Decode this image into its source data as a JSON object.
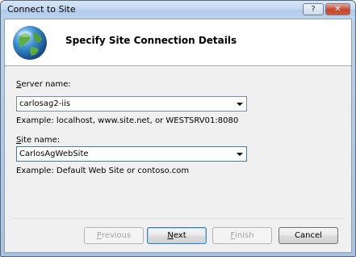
{
  "window": {
    "title": "Connect to Site",
    "help_glyph": "?",
    "close_glyph": "✕"
  },
  "header": {
    "title": "Specify Site Connection Details"
  },
  "server": {
    "label_accel": "S",
    "label_rest": "erver name:",
    "value": "carlosag2-iis",
    "example": "Example: localhost, www.site.net, or WESTSRV01:8080"
  },
  "site": {
    "label_accel": "S",
    "label_rest": "ite name:",
    "value": "CarlosAgWebSite",
    "example": "Example: Default Web Site or contoso.com"
  },
  "buttons": {
    "previous": {
      "accel": "P",
      "rest": "revious"
    },
    "next": {
      "accel": "N",
      "rest": "ext"
    },
    "finish": {
      "accel": "F",
      "rest": "inish"
    },
    "cancel": "Cancel"
  },
  "colors": {
    "accent": "#3c7fb1",
    "title_bar": "#c2d7ee"
  },
  "icons": {
    "header": "globe-icon"
  }
}
